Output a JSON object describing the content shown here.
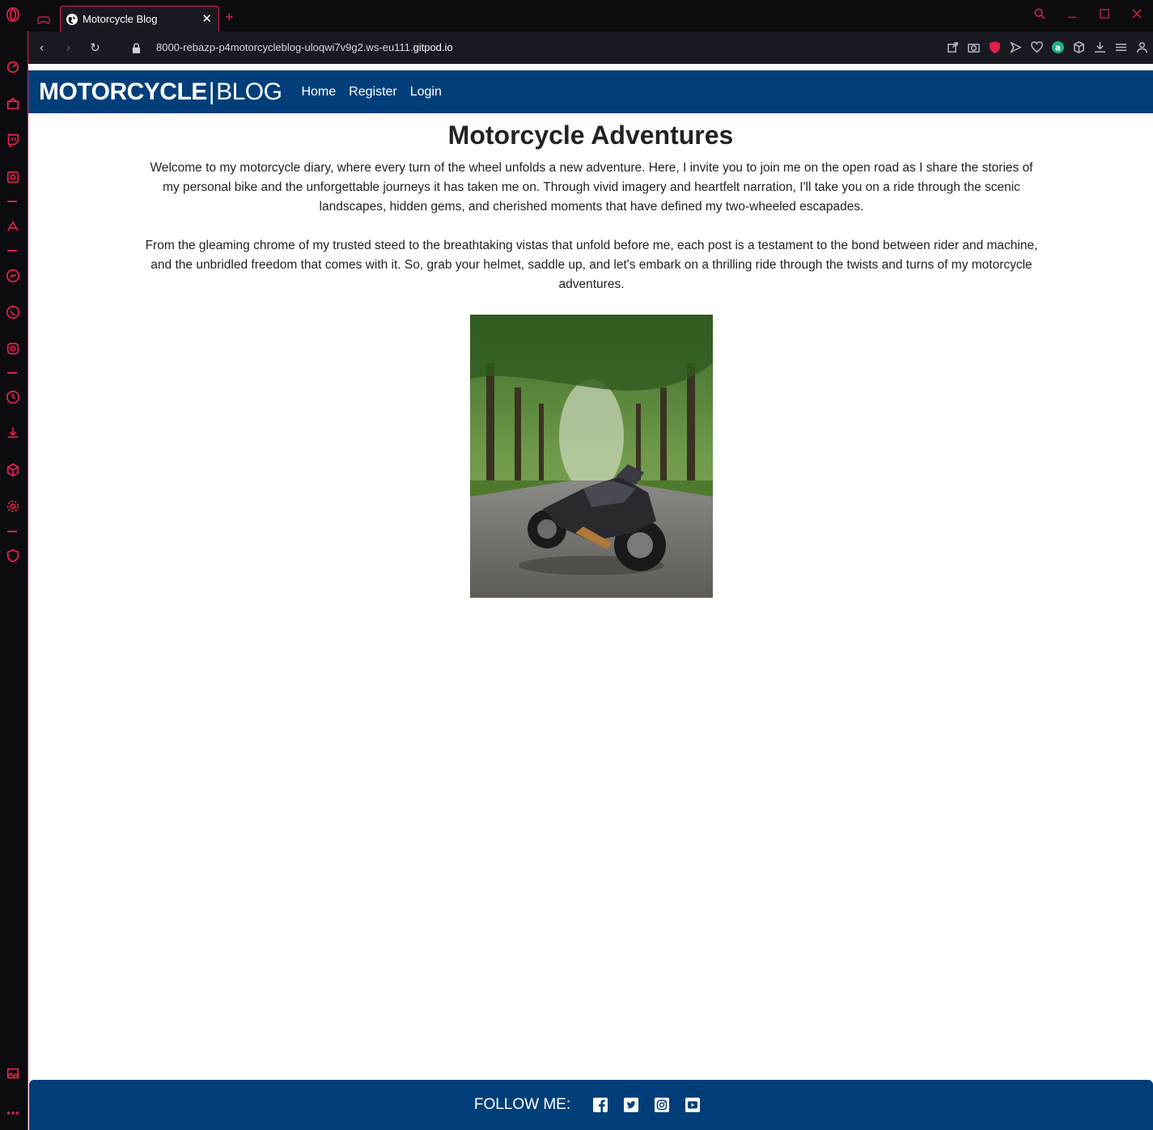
{
  "browser": {
    "tab_title": "Motorcycle Blog",
    "tab_close": "✕",
    "new_tab": "+",
    "url_prefix": "8000-rebazp-p4motorcycleblog-uloqwi7v9g2.ws-eu111.",
    "url_domain": "gitpod.io",
    "accent_color": "#e0204a"
  },
  "site": {
    "brand_bold": "MOTORCYCLE",
    "brand_sep": "|",
    "brand_light": "BLOG",
    "nav": [
      "Home",
      "Register",
      "Login"
    ],
    "heading": "Motorcycle Adventures",
    "paragraph1": "Welcome to my motorcycle diary, where every turn of the wheel unfolds a new adventure. Here, I invite you to join me on the open road as I share the stories of my personal bike and the unforgettable journeys it has taken me on. Through vivid imagery and heartfelt narration, I'll take you on a ride through the scenic landscapes, hidden gems, and cherished moments that have defined my two-wheeled escapades.",
    "paragraph2": "From the gleaming chrome of my trusted steed to the breathtaking vistas that unfold before me, each post is a testament to the bond between rider and machine, and the unbridled freedom that comes with it. So, grab your helmet, saddle up, and let's embark on a thrilling ride through the twists and turns of my motorcycle adventures.",
    "footer_label": "FOLLOW ME:",
    "social_icons": [
      "facebook-icon",
      "twitter-icon",
      "instagram-icon",
      "youtube-icon"
    ],
    "brand_color": "#023f7a"
  }
}
